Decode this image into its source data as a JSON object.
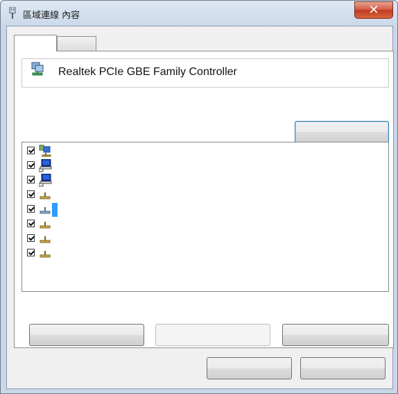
{
  "window": {
    "title": "區域連線 內容",
    "close_symbol": "✕"
  },
  "adapter": {
    "name": "Realtek PCIe GBE Family Controller",
    "icon": "network-adapter-icon"
  },
  "tabs": [
    {
      "label": "",
      "active": true
    },
    {
      "label": "",
      "active": false
    }
  ],
  "items": [
    {
      "checked": true,
      "icon": "network-client-icon",
      "selected": false
    },
    {
      "checked": true,
      "icon": "computer-service-icon",
      "selected": false
    },
    {
      "checked": true,
      "icon": "computer-service-icon",
      "selected": false
    },
    {
      "checked": true,
      "icon": "protocol-icon",
      "selected": false
    },
    {
      "checked": true,
      "icon": "protocol-icon",
      "selected": true
    },
    {
      "checked": true,
      "icon": "protocol-icon",
      "selected": false
    },
    {
      "checked": true,
      "icon": "protocol-icon",
      "selected": false
    },
    {
      "checked": true,
      "icon": "protocol-icon",
      "selected": false
    }
  ],
  "colors": {
    "selection": "#3399ff",
    "focus_border": "#3c7fb1"
  }
}
